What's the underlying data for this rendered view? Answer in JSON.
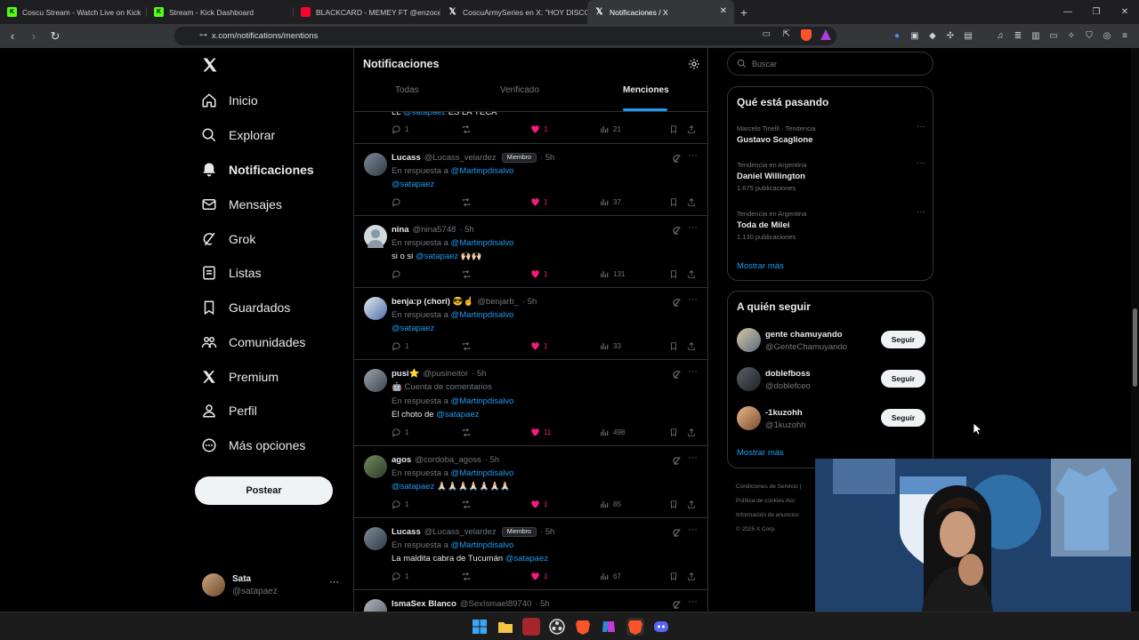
{
  "browser": {
    "tabs": [
      {
        "title": "Coscu Stream - Watch Live on Kick",
        "color": "#53fc18",
        "active": false
      },
      {
        "title": "Stream - Kick Dashboard",
        "color": "#53fc18",
        "active": false
      },
      {
        "title": "BLACKCARD - MEMEY FT @enzocero",
        "color": "#ff0033",
        "active": false
      },
      {
        "title": "CoscuArmySeries en X: \"HOY DISCOR",
        "color": "#ffffff",
        "active": false
      },
      {
        "title": "Notificaciones / X",
        "color": "#ffffff",
        "active": true
      }
    ],
    "new_tab": "+",
    "url": "x.com/notifications/mentions"
  },
  "sidebar": {
    "items": [
      {
        "label": "Inicio",
        "icon": "home-icon"
      },
      {
        "label": "Explorar",
        "icon": "search-icon"
      },
      {
        "label": "Notificaciones",
        "icon": "bell-icon"
      },
      {
        "label": "Mensajes",
        "icon": "mail-icon"
      },
      {
        "label": "Grok",
        "icon": "grok-icon"
      },
      {
        "label": "Listas",
        "icon": "list-icon"
      },
      {
        "label": "Guardados",
        "icon": "bookmark-icon"
      },
      {
        "label": "Comunidades",
        "icon": "communities-icon"
      },
      {
        "label": "Premium",
        "icon": "x-logo-icon"
      },
      {
        "label": "Perfil",
        "icon": "profile-icon"
      },
      {
        "label": "Más opciones",
        "icon": "more-circle-icon"
      }
    ],
    "post_button": "Postear",
    "account": {
      "name": "Sata",
      "handle": "@satapaez",
      "more": "···"
    }
  },
  "main": {
    "title": "Notificaciones",
    "tabs": [
      "Todas",
      "Verificado",
      "Menciones"
    ],
    "selected_tab": "Menciones",
    "partial_post": {
      "text_prefix": "LL ",
      "mention": "@satapaez",
      "text_suffix": " ES LA YECA",
      "replies": "1",
      "likes": "1",
      "views": "21"
    },
    "posts": [
      {
        "name": "Lucass",
        "handle": "@Lucass_velardez",
        "badge": "Miembro",
        "time": "· 5h",
        "reply_prefix": "En respuesta a",
        "reply_to": "@Martinpdisalvo",
        "line2_mention": "@satapaez",
        "line2_text": "",
        "replies": "",
        "likes": "1",
        "views": "37"
      },
      {
        "name": "nina",
        "handle": "@nina5748",
        "badge": "",
        "time": "· 5h",
        "reply_prefix": "En respuesta a",
        "reply_to": "@Martinpdisalvo",
        "body_text": "si o si ",
        "body_mention": "@satapaez",
        "body_suffix": " 🙌🏻🙌🏻",
        "replies": "",
        "likes": "1",
        "views": "131"
      },
      {
        "name": "benja:p (chori) 😎☝️",
        "handle": "@benjarb_",
        "badge": "",
        "time": "· 5h",
        "reply_prefix": "En respuesta a",
        "reply_to": "@Martinpdisalvo",
        "line2_mention": "@satapaez",
        "replies": "1",
        "likes": "1",
        "views": "33"
      },
      {
        "name": "pusi⭐",
        "handle": "@pusineitor",
        "badge": "",
        "time": "· 5h",
        "account_type": "🤖 Cuenta de comentarios",
        "reply_prefix": "En respuesta a",
        "reply_to": "@Martinpdisalvo",
        "body_text": "El choto de ",
        "body_mention": "@satapaez",
        "replies": "1",
        "likes": "11",
        "views": "498"
      },
      {
        "name": "agos",
        "handle": "@cordoba_agoss",
        "badge": "",
        "time": "· 5h",
        "reply_prefix": "En respuesta a",
        "reply_to": "@Martinpdisalvo",
        "line2_mention": "@satapaez",
        "line2_text": " 🙏🏻🙏🏻🙏🏻🙏🏻🙏🏻🙏🏻🙏🏻",
        "replies": "1",
        "likes": "1",
        "views": "85"
      },
      {
        "name": "Lucass",
        "handle": "@Lucass_velardez",
        "badge": "Miembro",
        "time": "· 5h",
        "reply_prefix": "En respuesta a",
        "reply_to": "@Martinpdisalvo",
        "body_text": "La maldita cabra de Tucumán ",
        "body_mention": "@satapaez",
        "replies": "1",
        "likes": "1",
        "views": "67"
      },
      {
        "name": "IsmaSex Blanco",
        "handle": "@SexIsmael89740",
        "badge": "",
        "time": "· 5h"
      }
    ]
  },
  "right": {
    "search_placeholder": "Buscar",
    "trends_title": "Qué está pasando",
    "trends": [
      {
        "context": "Marcelo Tinelli · Tendencia",
        "name": "Gustavo Scaglione",
        "posts": ""
      },
      {
        "context": "Tendencia en Argentina",
        "name": "Daniel Willington",
        "posts": "1.675 publicaciones"
      },
      {
        "context": "Tendencia en Argentina",
        "name": "Toda de Milei",
        "posts": "1.130 publicaciones"
      }
    ],
    "trends_more": "Mostrar más",
    "who_title": "A quién seguir",
    "who": [
      {
        "name": "gente chamuyando",
        "handle": "@GenteChamuyando",
        "button": "Seguir"
      },
      {
        "name": "doblefboss",
        "handle": "@doblefceo",
        "button": "Seguir"
      },
      {
        "name": "-1kuzohh",
        "handle": "@1kuzohh",
        "button": "Seguir"
      }
    ],
    "who_more": "Mostrar más",
    "footer": [
      "Condiciones de Servicio |",
      "Política de cookies   Acc",
      "Información de anuncios",
      "© 2025 X Corp."
    ]
  },
  "colors": {
    "accent": "#1d9bf0",
    "like": "#f91880",
    "border": "#2f3336",
    "muted": "#71767b"
  }
}
